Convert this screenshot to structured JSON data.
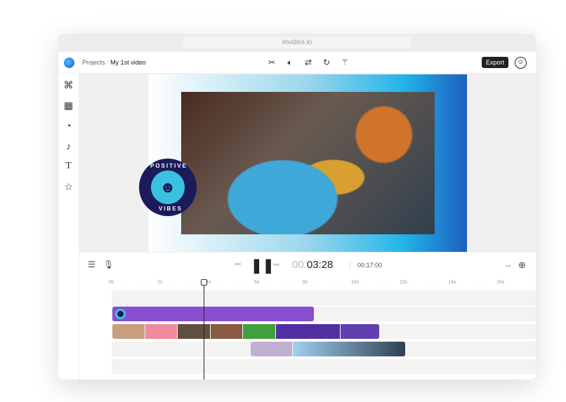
{
  "browser": {
    "url": "invideo.io"
  },
  "header": {
    "breadcrumb_root": "Projects",
    "separator": "/",
    "project_name": "My 1st video",
    "tools": [
      "scissors-icon",
      "volume-icon",
      "swap-icon",
      "rotate-icon",
      "magic-wand-icon"
    ],
    "export_label": "Export"
  },
  "sidebar": {
    "items": [
      "elements-icon",
      "media-icon",
      "stickers-icon",
      "music-icon",
      "text-icon",
      "favorites-icon"
    ]
  },
  "preview": {
    "sticker_top": "POSITIVE",
    "sticker_bottom": "VIBES"
  },
  "timeline": {
    "current_time_dim": "00:",
    "current_time": "03:28",
    "total_time": "00:17:00",
    "ruler": [
      "0s",
      "2s",
      "4s",
      "6s",
      "8s",
      "10s",
      "12s",
      "14s",
      "16s"
    ],
    "playhead_seconds": 3.9
  }
}
